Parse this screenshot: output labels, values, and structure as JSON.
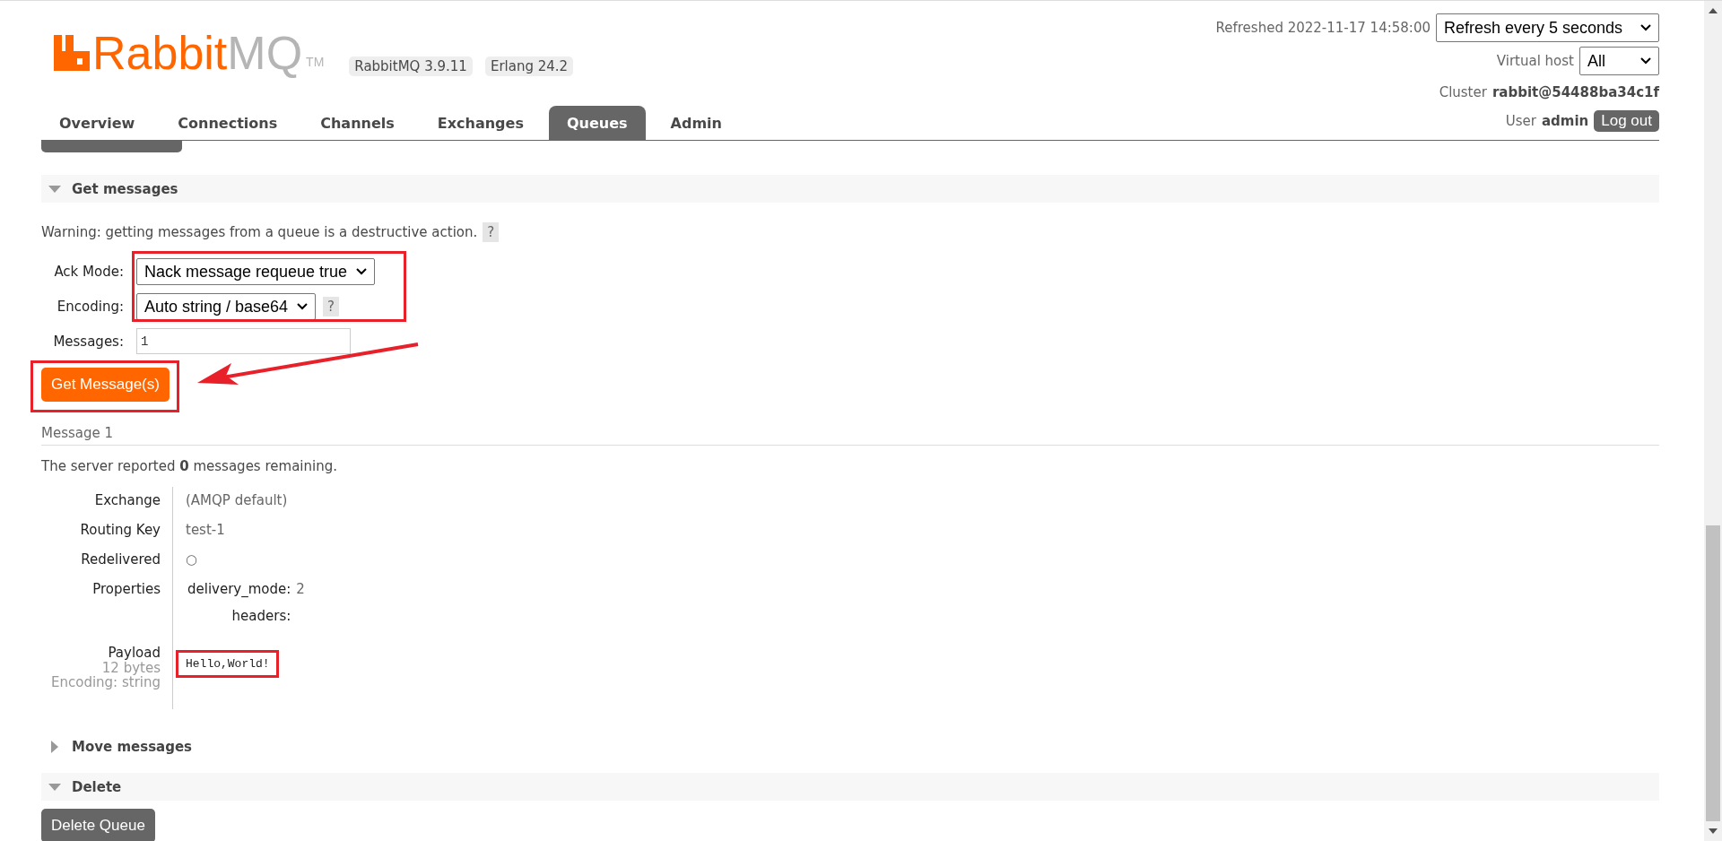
{
  "logo": {
    "brand": "Rabbit",
    "suffix": "MQ",
    "tm": "TM"
  },
  "versions": [
    "RabbitMQ 3.9.11",
    "Erlang 24.2"
  ],
  "refreshed": "Refreshed 2022-11-17 14:58:00",
  "refresh_select": "Refresh every 5 seconds",
  "vhost": {
    "label": "Virtual host",
    "value": "All"
  },
  "cluster": {
    "label": "Cluster",
    "value": "rabbit@54488ba34c1f"
  },
  "user": {
    "label": "User",
    "value": "admin"
  },
  "logout": "Log out",
  "tabs": [
    {
      "label": "Overview",
      "selected": false
    },
    {
      "label": "Connections",
      "selected": false
    },
    {
      "label": "Channels",
      "selected": false
    },
    {
      "label": "Exchanges",
      "selected": false
    },
    {
      "label": "Queues",
      "selected": true
    },
    {
      "label": "Admin",
      "selected": false
    }
  ],
  "get_messages": {
    "title": "Get messages",
    "expanded": true,
    "warning": "Warning: getting messages from a queue is a destructive action.",
    "help": "?",
    "ack_mode": {
      "label": "Ack Mode:",
      "value": "Nack message requeue true"
    },
    "encoding": {
      "label": "Encoding:",
      "value": "Auto string / base64",
      "help": "?"
    },
    "messages": {
      "label": "Messages:",
      "value": "1"
    },
    "button": "Get Message(s)"
  },
  "message": {
    "title": "Message 1",
    "remaining": "The server reported **0** messages remaining.",
    "fields": [
      {
        "label": "Exchange",
        "value": "(AMQP default)"
      },
      {
        "label": "Routing Key",
        "value": "test-1"
      },
      {
        "label": "Redelivered",
        "value": "○"
      }
    ],
    "properties_label": "Properties",
    "properties": [
      {
        "key": "delivery_mode:",
        "value": "2"
      },
      {
        "key": "headers:"
      }
    ],
    "payload": {
      "label": "Payload",
      "size": "12 bytes",
      "encoding": "Encoding: string",
      "value": "Hello,World!"
    }
  },
  "sections": [
    {
      "title": "Move messages",
      "expanded": false
    },
    {
      "title": "Delete",
      "expanded": true
    }
  ],
  "delete_button": "Delete Queue"
}
